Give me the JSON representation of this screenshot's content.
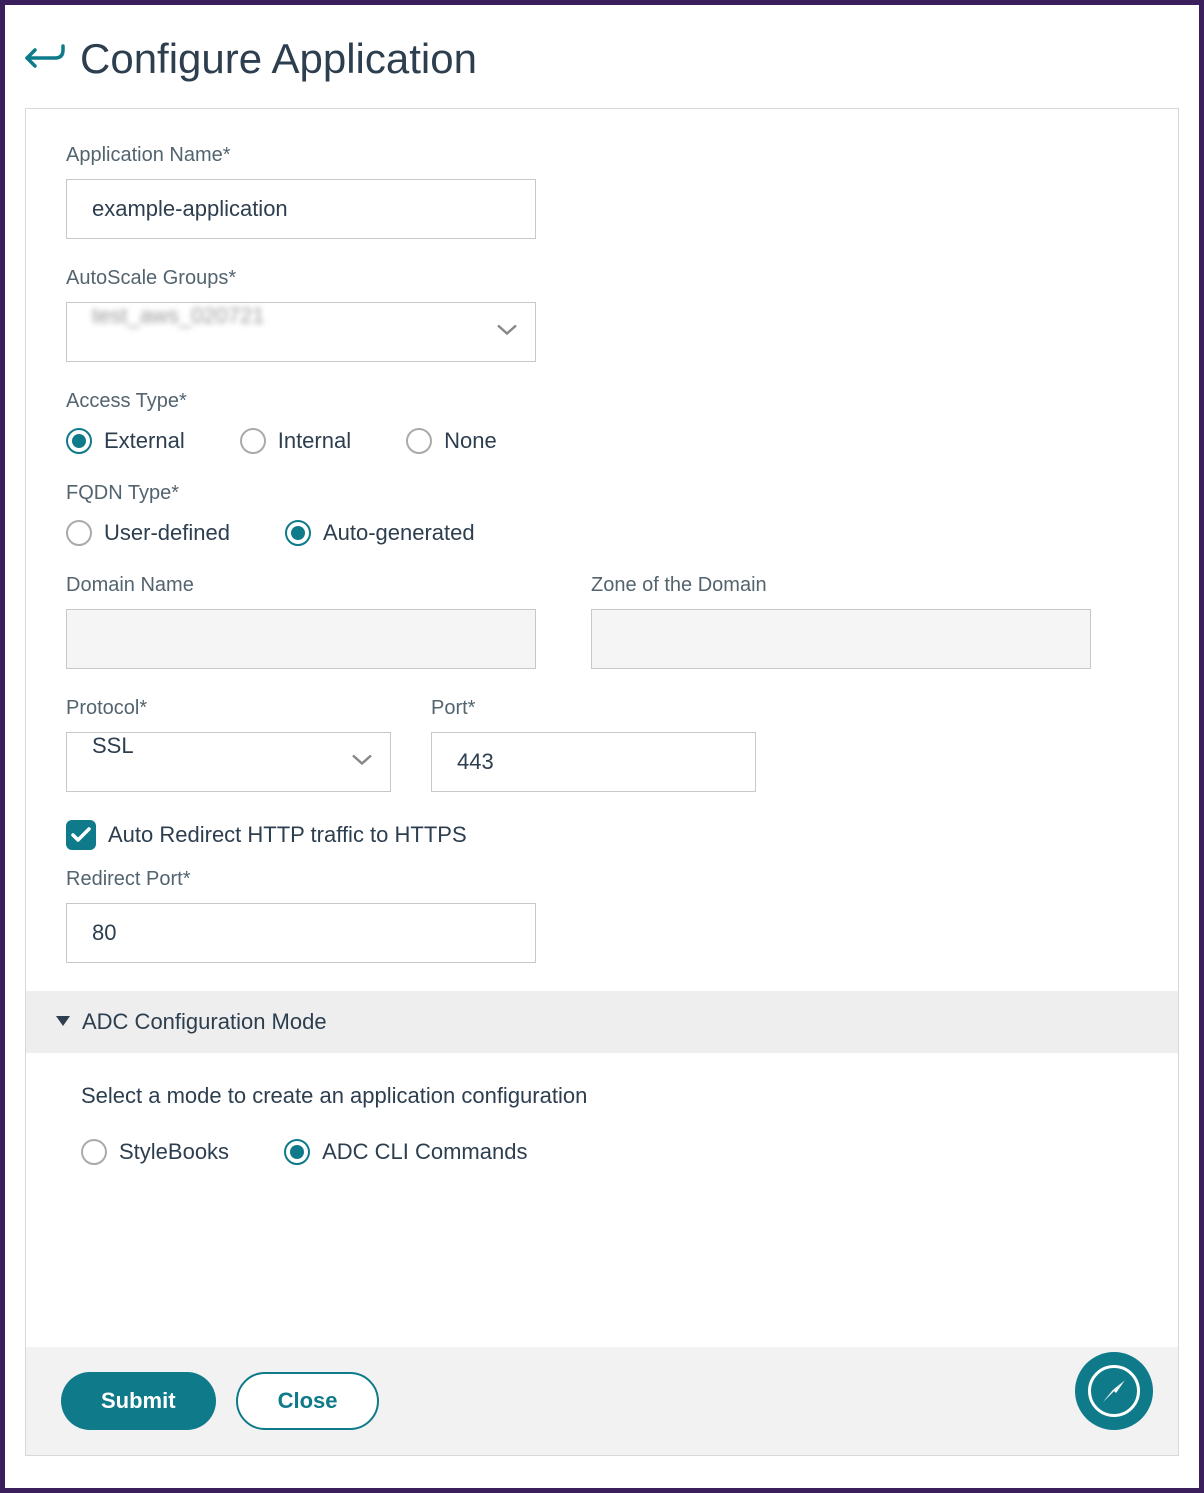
{
  "header": {
    "title": "Configure Application"
  },
  "fields": {
    "app_name_label": "Application Name*",
    "app_name_value": "example-application",
    "autoscale_label": "AutoScale Groups*",
    "autoscale_value": "test_aws_020721",
    "access_type_label": "Access Type*",
    "access_type_options": {
      "external": "External",
      "internal": "Internal",
      "none": "None"
    },
    "fqdn_type_label": "FQDN Type*",
    "fqdn_type_options": {
      "user_defined": "User-defined",
      "auto_generated": "Auto-generated"
    },
    "domain_name_label": "Domain Name",
    "zone_label": "Zone of the Domain",
    "protocol_label": "Protocol*",
    "protocol_value": "SSL",
    "port_label": "Port*",
    "port_value": "443",
    "auto_redirect_label": "Auto Redirect HTTP traffic to HTTPS",
    "redirect_port_label": "Redirect Port*",
    "redirect_port_value": "80"
  },
  "accordion": {
    "title": "ADC Configuration Mode",
    "description": "Select a mode to create an application configuration",
    "options": {
      "stylebooks": "StyleBooks",
      "cli": "ADC CLI Commands"
    }
  },
  "footer": {
    "submit_label": "Submit",
    "close_label": "Close"
  }
}
